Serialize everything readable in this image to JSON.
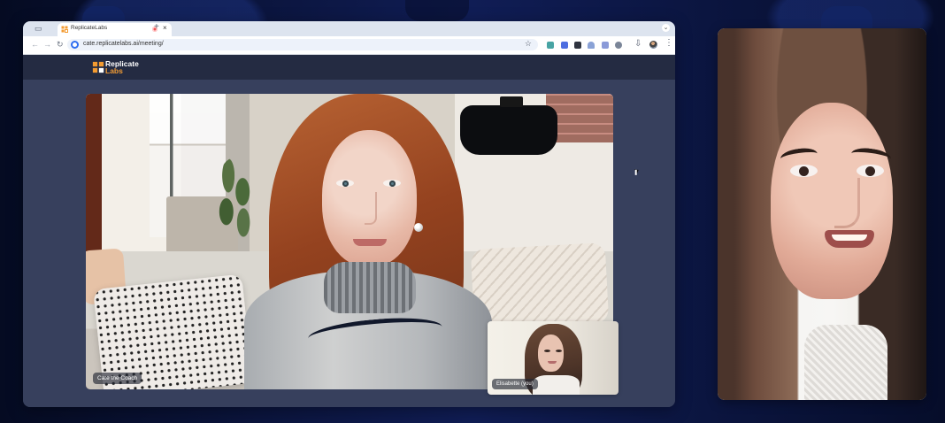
{
  "browser": {
    "tab": {
      "title": "ReplicateLabs",
      "close_symbol": "×",
      "favicon": "replicatelabs-icon",
      "recording_indicator": "record-icon"
    },
    "new_tab_symbol": "+",
    "tab_dropdown_symbol": "⌄",
    "address_bar": {
      "url": "cate.replicatelabs.ai/meeting/",
      "site_info_icon": "site-info-icon",
      "bookmark_symbol": "☆"
    },
    "navigation": {
      "back_symbol": "←",
      "forward_symbol": "→",
      "reload_symbol": "↻"
    },
    "toolbar_icons": [
      "extension-icon-1",
      "extension-icon-2",
      "extension-icon-3",
      "extension-icon-4",
      "extension-icon-5",
      "extensions-icon",
      "download-icon",
      "profile-avatar",
      "menu-kebab-icon"
    ],
    "download_symbol": "⇩",
    "menu_symbol": "⋮"
  },
  "app": {
    "brand": {
      "line1": "Replicate",
      "line2": "Labs",
      "mark_colors": [
        "#f39b31",
        "#ffffff"
      ]
    },
    "meeting": {
      "main_participant": "Cate the Coach",
      "self_participant": "Elisabette (you)"
    }
  },
  "colors": {
    "page_background": "#071033",
    "browser_content": "#37405d",
    "app_header": "#242b42",
    "brand_accent": "#ef9a34",
    "recording_red": "#ef4f52"
  }
}
